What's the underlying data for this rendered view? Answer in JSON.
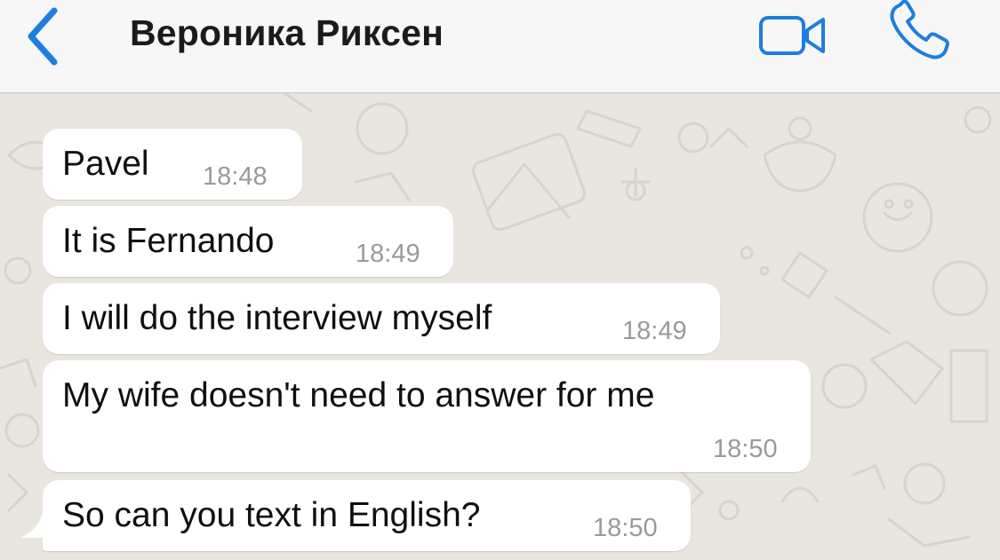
{
  "header": {
    "title": "Вероника Риксен",
    "back_icon": "chevron-left-icon",
    "video_icon": "video-camera-icon",
    "call_icon": "phone-icon",
    "accent_color": "#1d7ee0"
  },
  "messages": [
    {
      "text": "Pavel",
      "time": "18:48"
    },
    {
      "text": "It is Fernando",
      "time": "18:49"
    },
    {
      "text": "I will do the interview myself",
      "time": "18:49"
    },
    {
      "text": "My wife doesn't need to answer for me",
      "time": "18:50"
    },
    {
      "text": "So can you text in English?",
      "time": "18:50"
    }
  ]
}
